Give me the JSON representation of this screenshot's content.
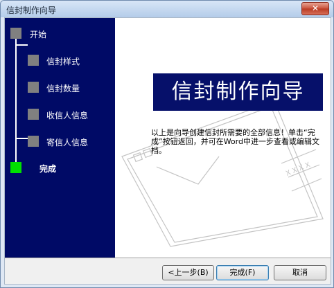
{
  "window": {
    "title": "信封制作向导",
    "close_label": "✕"
  },
  "steps": [
    {
      "label": "开始",
      "status": "pending"
    },
    {
      "label": "信封样式",
      "status": "pending"
    },
    {
      "label": "信封数量",
      "status": "pending"
    },
    {
      "label": "收信人信息",
      "status": "pending"
    },
    {
      "label": "寄信人信息",
      "status": "pending"
    },
    {
      "label": "完成",
      "status": "current"
    }
  ],
  "content": {
    "banner": "信封制作向导",
    "description": "以上是向导创建信封所需要的全部信息！单击“完成”按钮返回，并可在Word中进一步查看或编辑文档。"
  },
  "buttons": {
    "back": "<上一步(B)",
    "finish": "完成(F)",
    "cancel": "取消"
  },
  "colors": {
    "sidebar": "#000a66",
    "banner": "#06106a",
    "active_step": "#00e000",
    "inactive_step": "#808080"
  }
}
